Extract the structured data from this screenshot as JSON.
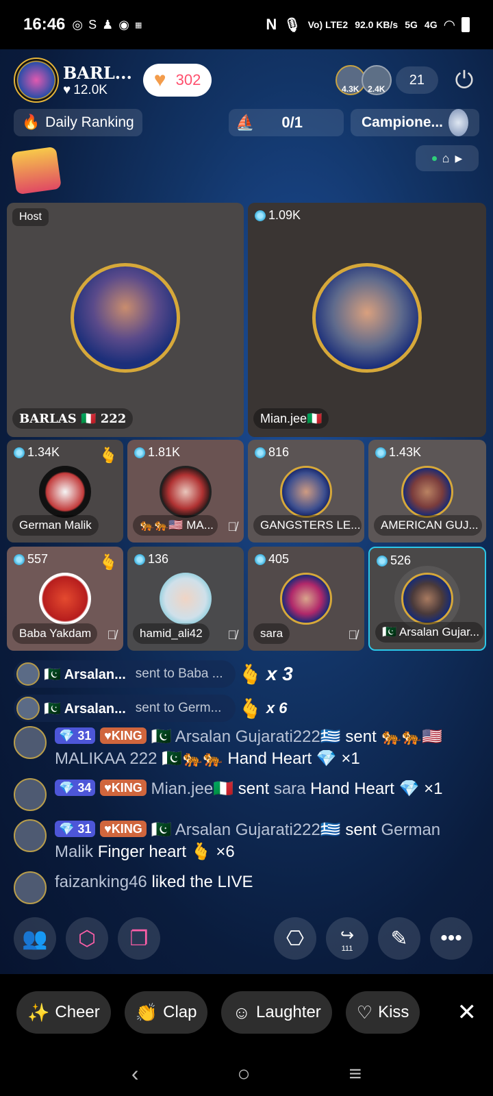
{
  "status_bar": {
    "time": "16:46",
    "app_icons": [
      "whatsapp-icon",
      "s-icon",
      "snapchat-icon",
      "messenger-icon",
      "temu-icon"
    ],
    "network_text": "Vo) LTE2",
    "speed": "92.0 KB/s",
    "signal_1": "5G",
    "signal_2": "4G"
  },
  "header": {
    "host_name": "BARL...",
    "host_likes": "12.0K",
    "heart_count": "302",
    "viewer_1_score": "4.3K",
    "viewer_2_score": "2.4K",
    "viewer_count": "21"
  },
  "ranking": {
    "daily_label": "Daily Ranking",
    "score": "0/1",
    "campione_label": "Campione..."
  },
  "tiles": {
    "host": {
      "badge": "Host",
      "name": "BARLAS 🇮🇹 222"
    },
    "guest_main": {
      "coins": "1.09K",
      "name": "Mian.jee🇮🇹"
    },
    "grid": [
      {
        "coins": "1.34K",
        "name": "German Malik",
        "hand": true,
        "muted": false
      },
      {
        "coins": "1.81K",
        "name": "🐅🐅🇺🇸 MA...",
        "hand": false,
        "muted": true
      },
      {
        "coins": "816",
        "name": "GANGSTERS LE...",
        "hand": false,
        "muted": false
      },
      {
        "coins": "1.43K",
        "name": "AMERICAN GUJ...",
        "hand": false,
        "muted": false
      },
      {
        "coins": "557",
        "name": "Baba Yakdam",
        "hand": true,
        "muted": true
      },
      {
        "coins": "136",
        "name": "hamid_ali42",
        "hand": false,
        "muted": true
      },
      {
        "coins": "405",
        "name": "sara",
        "hand": false,
        "muted": true
      },
      {
        "coins": "526",
        "name": "🇵🇰 Arsalan Gujar...",
        "hand": false,
        "muted": false
      }
    ]
  },
  "gift_banners": [
    {
      "sender": "🇵🇰 Arsalan...",
      "to": "sent to Baba ...",
      "multiplier": "x 3"
    },
    {
      "sender": "🇵🇰 Arsalan...",
      "to": "sent to Germ...",
      "multiplier": "x 6"
    }
  ],
  "chat": [
    {
      "level": "31",
      "rank": "KING",
      "name": "🇵🇰 Arsalan Gujarati222🇬🇷",
      "verb": "sent",
      "target": "🐅🐅🇺🇸 MALIKAA 222 🇵🇰🐅🐅",
      "gift": "Hand Heart",
      "gift_icon": "💎",
      "count": "×1"
    },
    {
      "level": "34",
      "rank": "KING",
      "name": "Mian.jee🇮🇹",
      "verb": "sent",
      "target": "sara",
      "gift": "Hand Heart",
      "gift_icon": "💎",
      "count": "×1"
    },
    {
      "level": "31",
      "rank": "KING",
      "name": "🇵🇰 Arsalan Gujarati222🇬🇷",
      "verb": "sent",
      "target": "German Malik",
      "gift": "Finger heart",
      "gift_icon": "🫰",
      "count": "×6"
    },
    {
      "name": "faizanking46",
      "text": "liked the LIVE"
    }
  ],
  "reactions": [
    {
      "label": "Cheer",
      "icon": "cheer-icon"
    },
    {
      "label": "Clap",
      "icon": "clap-icon"
    },
    {
      "label": "Laughter",
      "icon": "laughter-icon"
    },
    {
      "label": "Kiss",
      "icon": "kiss-icon"
    }
  ],
  "share_count": "111",
  "colors": {
    "accent_pink": "#ff5fa8",
    "heart_count_red": "#ff4f6d",
    "selected_border": "#2cc8e8",
    "level_badge": "#4d56d8",
    "king_badge": "#d0663d"
  }
}
